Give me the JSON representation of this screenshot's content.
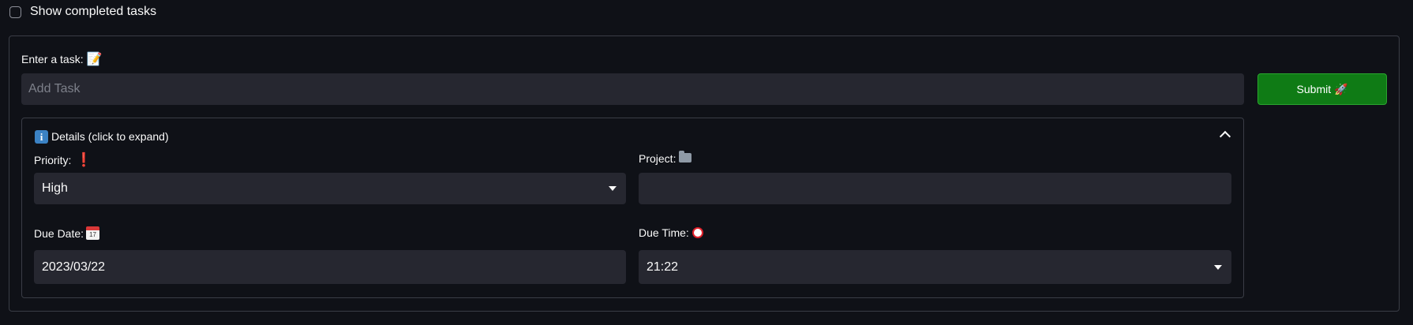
{
  "show_completed": {
    "label": "Show completed tasks",
    "checked": false
  },
  "task_form": {
    "label": "Enter a task:",
    "label_emoji": "📝",
    "input_placeholder": "Add Task",
    "input_value": "",
    "submit_label": "Submit 🚀",
    "accent_color": "#0f7b15"
  },
  "details": {
    "title": "Details (click to expand)",
    "expanded": true,
    "priority": {
      "label": "Priority:",
      "mark": "❗",
      "value": "High"
    },
    "project": {
      "label": "Project:",
      "value": ""
    },
    "due_date": {
      "label": "Due Date:",
      "icon_text": "17",
      "value": "2023/03/22"
    },
    "due_time": {
      "label": "Due Time:",
      "value": "21:22"
    }
  },
  "icons": {
    "info": "info-icon",
    "chevron": "chevron-up-icon",
    "caret": "caret-down-icon",
    "folder": "folder-icon",
    "calendar": "calendar-icon",
    "alarm": "alarm-clock-icon"
  }
}
